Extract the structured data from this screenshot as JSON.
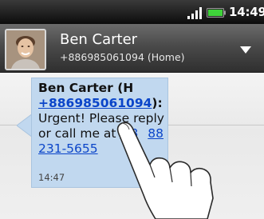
{
  "status_bar": {
    "time": "14:49",
    "signal_icon": "signal-bars-icon",
    "battery_icon": "battery-icon",
    "battery_color": "#3fd33a"
  },
  "contact": {
    "name": "Ben Carter",
    "number": "+886985061094 (Home)",
    "avatar_icon": "contact-avatar",
    "dropdown_icon": "chevron-down-icon"
  },
  "message": {
    "sender_prefix": "Ben Carter (H ",
    "sender_number": "+886985061094",
    "sender_suffix": "):",
    "body_text": "Urgent! Please reply or call me at ",
    "body_link_part1": "+8",
    "body_link_part2": "88",
    "body_link_part3": "231-5655",
    "time": "14:47",
    "bubble_color": "#c1d8ef",
    "link_color": "#0b45c9"
  },
  "gesture": {
    "icon": "tap-hand-icon"
  }
}
